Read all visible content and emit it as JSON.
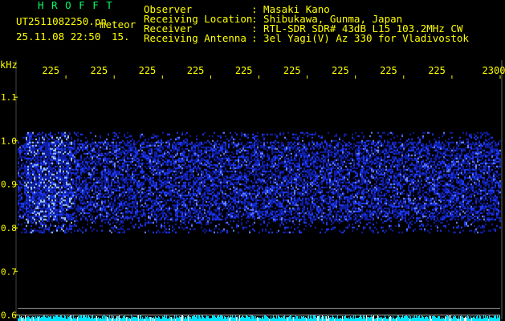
{
  "app": {
    "name": "H R O F F T",
    "file": "UT2511082250.pn",
    "tag": "meteor",
    "datetime": "25.11.08 22:50",
    "interval": "15."
  },
  "info": {
    "labels": [
      "Observer",
      "Receiving Location",
      "Receiver",
      "Receiving Antenna"
    ],
    "values": [
      ": Masaki Kano",
      ": Shibukawa, Gunma, Japan",
      ": RTL-SDR SDR# 43dB L15 103.2MHz CW",
      ": 3el Yagi(V) Az 330 for Vladivostok"
    ]
  },
  "colors": {
    "text": "#ffff00",
    "title": "#00ff66",
    "signal": "#1e3cff",
    "baseline": "#00e5ff",
    "background": "#000000"
  },
  "chart_data": {
    "type": "heatmap",
    "ylabel": "kHz",
    "yticks": [
      "1.1",
      "1.0",
      "0.9",
      "0.8",
      "0.7",
      "0.6"
    ],
    "ytick_values": [
      1.1,
      1.0,
      0.9,
      0.8,
      0.7,
      0.6
    ],
    "ylim": [
      0.59,
      1.15
    ],
    "xticks": [
      "225",
      "225",
      "225",
      "225",
      "225",
      "225",
      "225",
      "225",
      "225",
      "2300"
    ],
    "xtick_values": [
      1,
      2,
      3,
      4,
      5,
      6,
      7,
      8,
      9,
      10
    ],
    "xlim": [
      0,
      10
    ],
    "noise_band_khz": [
      0.79,
      1.02
    ],
    "strong_band_khz": [
      0.82,
      1.0
    ],
    "intense_segments": [
      [
        0.15,
        1.1
      ]
    ],
    "grid": false
  }
}
